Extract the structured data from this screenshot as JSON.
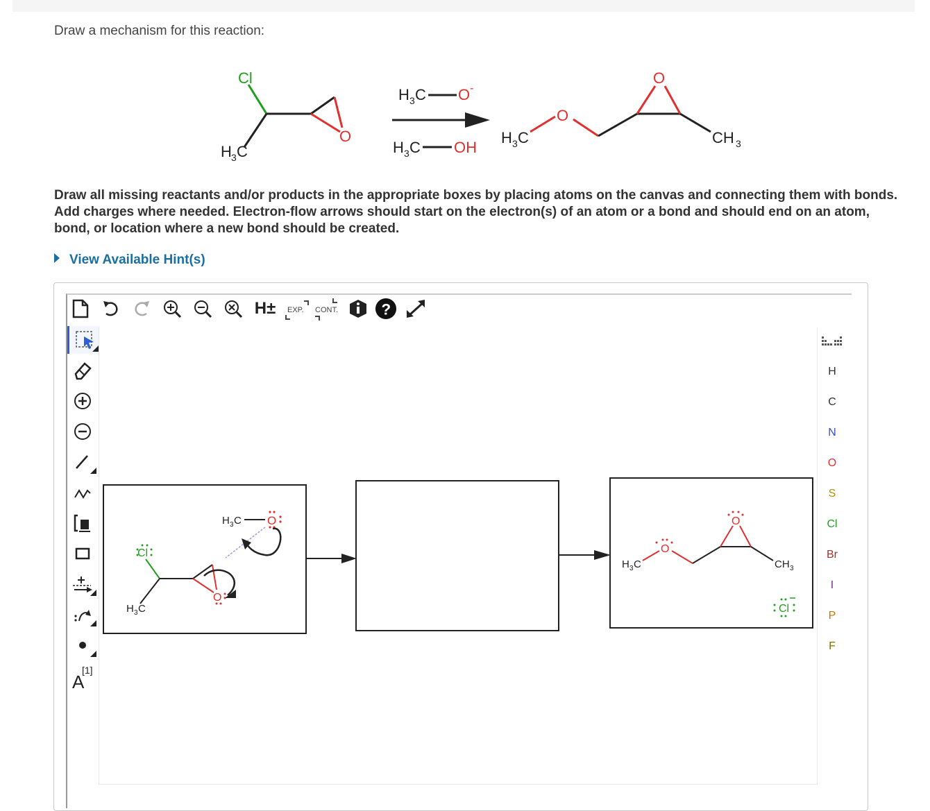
{
  "question": {
    "prompt": "Draw a mechanism for this reaction:",
    "instructions": "Draw all missing reactants and/or products in the appropriate boxes by placing atoms on the canvas and connecting them with bonds. Add charges where needed. Electron-flow arrows should start on the electron(s) of an atom or a bond and should end on an atom, bond, or location where a new bond should be created.",
    "hint_link": "View Available Hint(s)"
  },
  "reaction": {
    "reactant_cl": "Cl",
    "reactant_o": "O",
    "reactant_h3c": "H",
    "reagent_top": "H",
    "reagent_top_o": "O",
    "reagent_top_charge": "-",
    "reagent_bottom": "H",
    "reagent_bottom_oh": "OH",
    "product_h3c": "H",
    "product_o1": "O",
    "product_o2": "O",
    "product_ch3": "CH",
    "sub3": "3"
  },
  "toolbar": {
    "h_toggle": "H±",
    "exp": "EXP.",
    "cont": "CONT."
  },
  "lefttools": {
    "charge_label": "[1]",
    "atom_label": "A"
  },
  "periodic": [
    "H",
    "C",
    "N",
    "O",
    "S",
    "Cl",
    "Br",
    "I",
    "P",
    "F"
  ],
  "periodic_colors": {
    "H": "#333333",
    "C": "#333333",
    "N": "#3050c8",
    "O": "#e03030",
    "S": "#b09000",
    "Cl": "#20a020",
    "Br": "#a03030",
    "I": "#7030a0",
    "P": "#d07000",
    "F": "#807000"
  },
  "canvas": {
    "box1": {
      "h3c_o": "H",
      "o_label": "O",
      "cl": "Cl",
      "h3c": "H",
      "epo_o": "O"
    },
    "box3": {
      "h3c": "H",
      "o": "O",
      "o_top": "O",
      "ch3": "CH",
      "cl": "Cl"
    }
  }
}
